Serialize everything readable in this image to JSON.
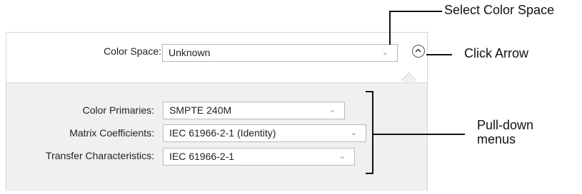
{
  "panel": {
    "color_space_label": "Color Space:",
    "color_space_value": "Unknown",
    "rows": [
      {
        "label": "Color Primaries:",
        "value": "SMPTE 240M"
      },
      {
        "label": "Matrix Coefficients:",
        "value": "IEC 61966-2-1 (Identity)"
      },
      {
        "label": "Transfer Characteristics:",
        "value": "IEC 61966-2-1"
      }
    ]
  },
  "icons": {
    "dropdown": "chevron-down-icon",
    "collapse": "chevron-up-circle-icon"
  },
  "annotations": {
    "select_color_space": "Select Color Space",
    "click_arrow": "Click Arrow",
    "pulldown_line1": "Pull-down",
    "pulldown_line2": "menus"
  },
  "colors": {
    "panel_gray": "#f0f0f0",
    "border": "#b9b9b9"
  }
}
